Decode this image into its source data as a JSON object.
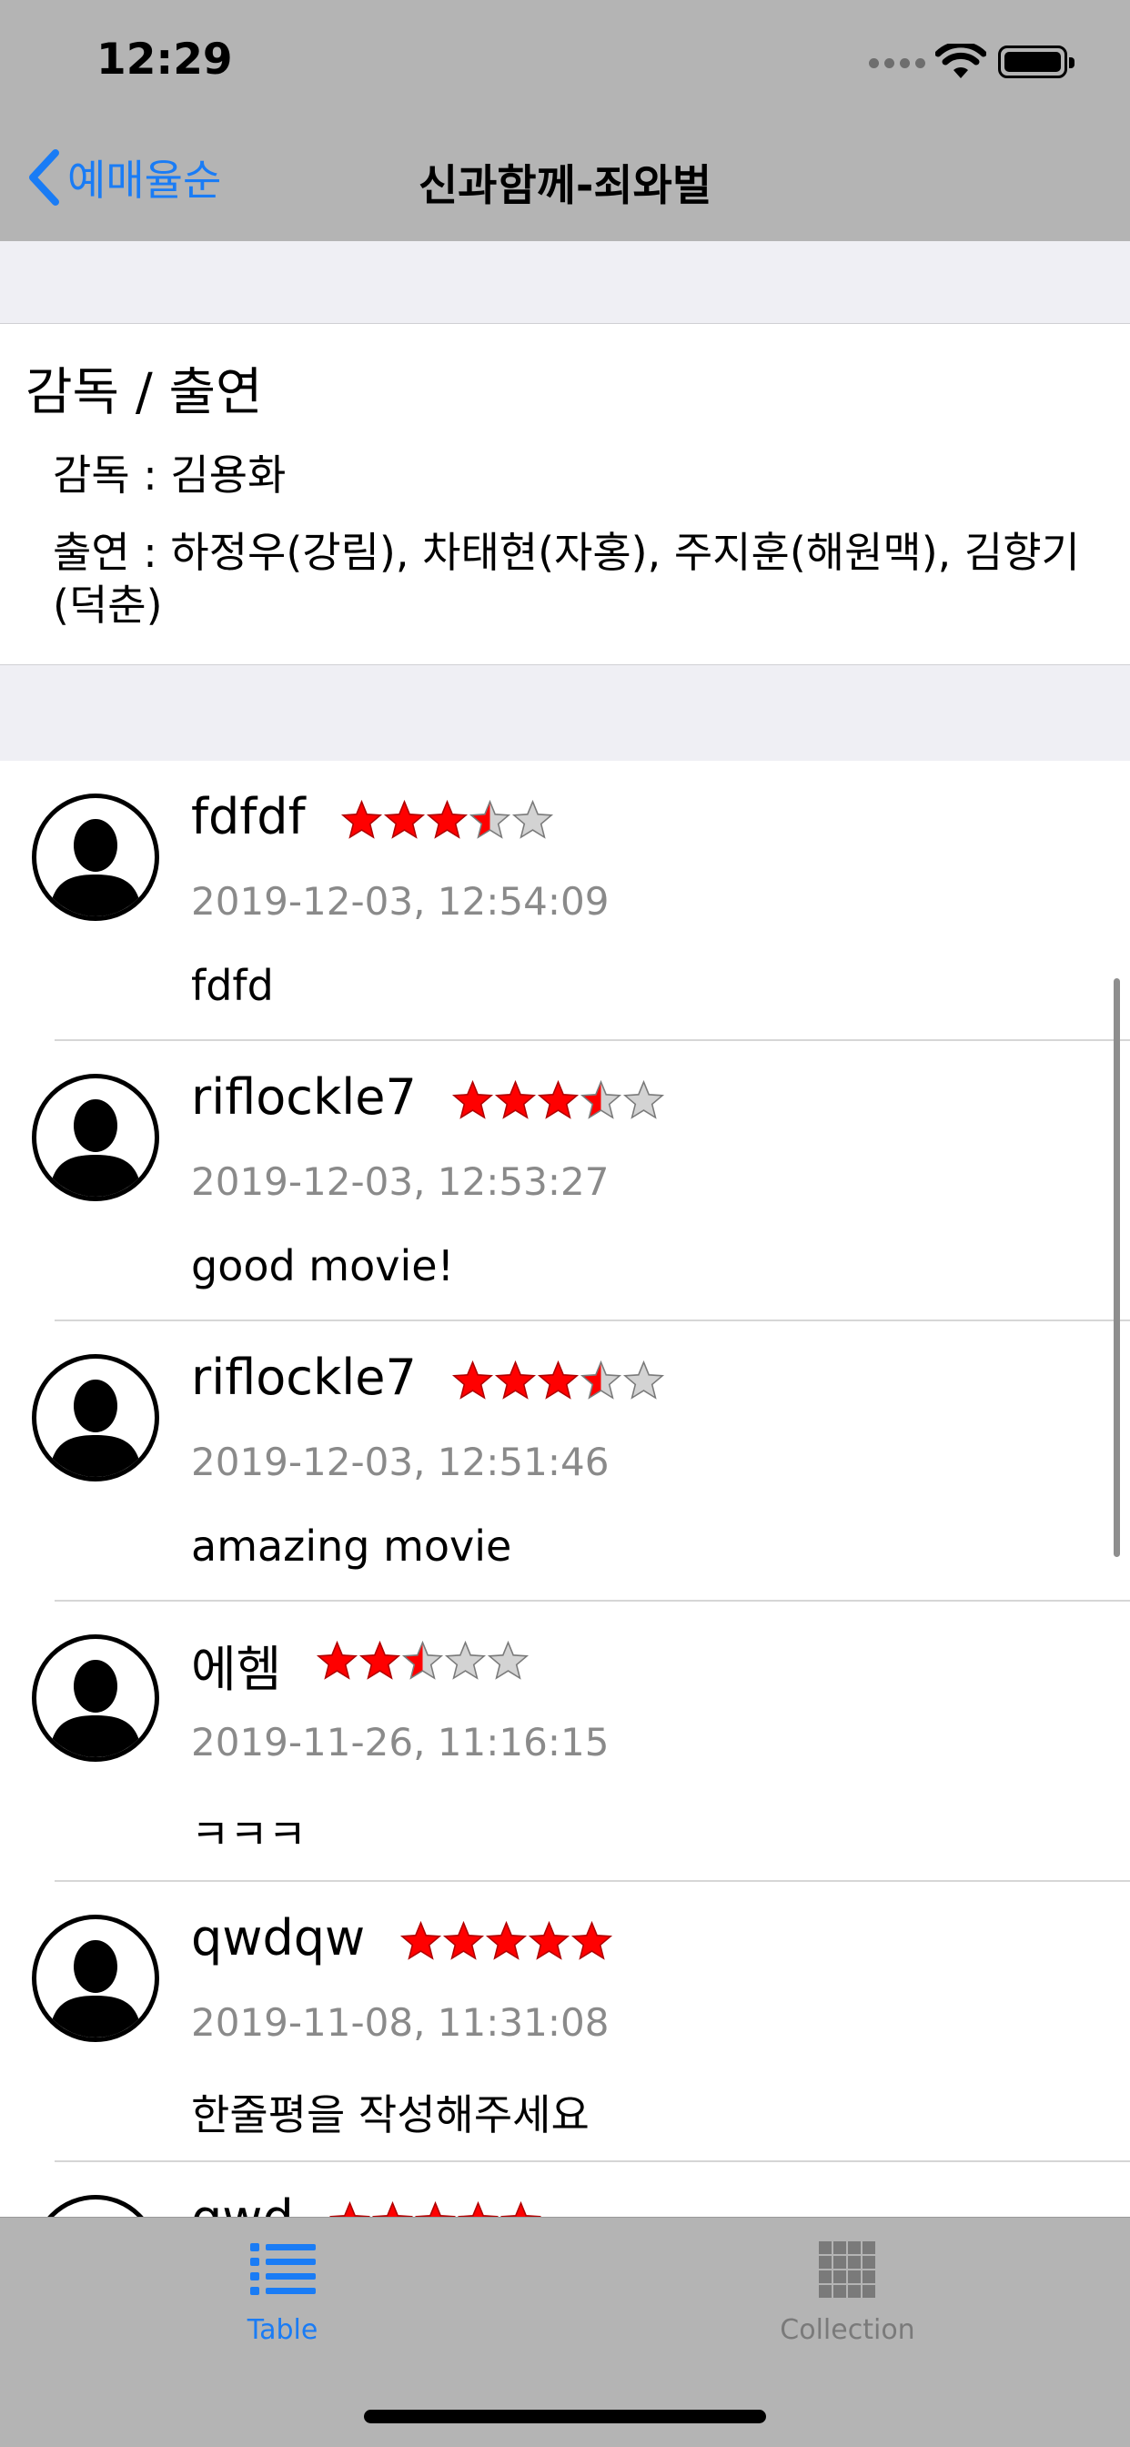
{
  "status_bar": {
    "time": "12:29"
  },
  "nav": {
    "back_label": "예매율순",
    "title": "신과함께-죄와벌"
  },
  "credits": {
    "heading": "감독 / 출연",
    "director": "감독 : 김용화",
    "cast": "출연 : 하정우(강림), 차태현(자홍), 주지훈(해원맥), 김향기(덕춘)"
  },
  "reviews": [
    {
      "nickname": "fdfdf",
      "rating_out_of_5": 3.5,
      "date": "2019-12-03, 12:54:09",
      "comment": "fdfd"
    },
    {
      "nickname": "riflockle7",
      "rating_out_of_5": 3.5,
      "date": "2019-12-03, 12:53:27",
      "comment": "good movie!"
    },
    {
      "nickname": "riflockle7",
      "rating_out_of_5": 3.5,
      "date": "2019-12-03, 12:51:46",
      "comment": "amazing movie"
    },
    {
      "nickname": "에헴",
      "rating_out_of_5": 2.5,
      "date": "2019-11-26, 11:16:15",
      "comment": "ㅋㅋㅋ"
    },
    {
      "nickname": "qwdqw",
      "rating_out_of_5": 5,
      "date": "2019-11-08, 11:31:08",
      "comment": "한줄평을 작성해주세요"
    },
    {
      "nickname": "qwd",
      "rating_out_of_5": 5,
      "date": "",
      "comment": ""
    }
  ],
  "tab_bar": {
    "tabs": [
      {
        "label": "Table",
        "icon": "list-icon",
        "selected": true
      },
      {
        "label": "Collection",
        "icon": "grid-icon",
        "selected": false
      }
    ]
  },
  "colors": {
    "accent": "#1a7cf5",
    "star_filled": "#ff0000",
    "star_empty": "#d3d3d3",
    "bar_background": "#b4b4b4",
    "section_background": "#efeff4"
  }
}
